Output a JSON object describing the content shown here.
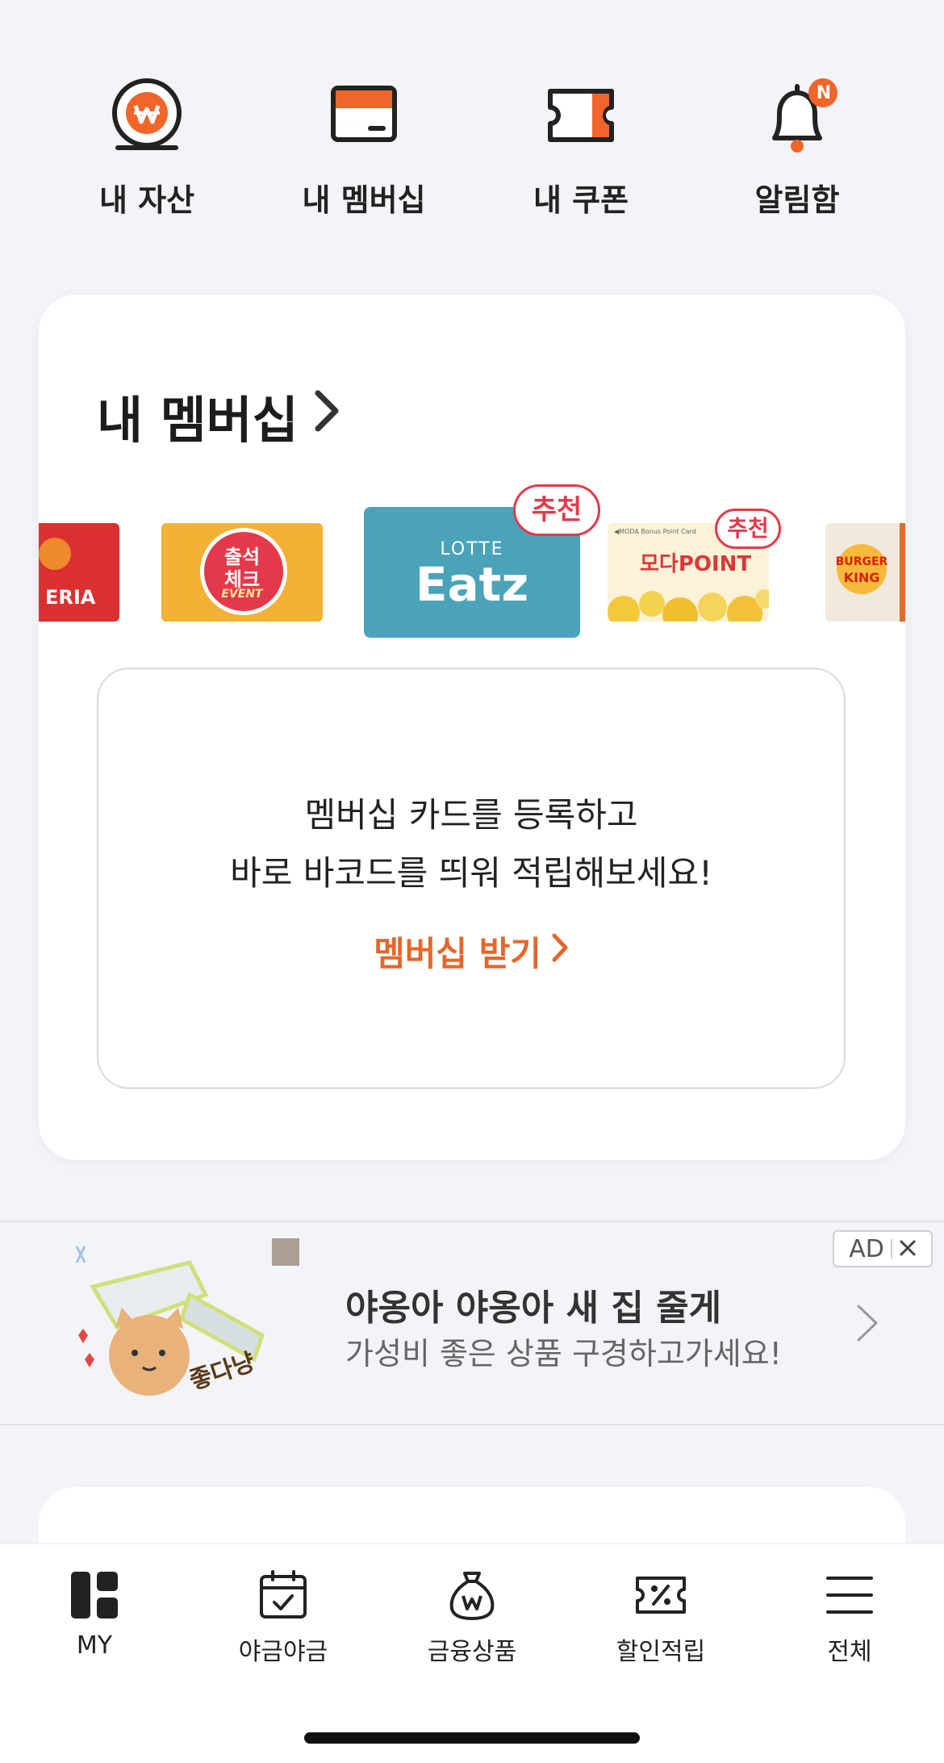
{
  "quick_menu": {
    "assets_label": "내 자산",
    "membership_label": "내 멤버십",
    "coupon_label": "내 쿠폰",
    "alarm_label": "알림함",
    "alarm_badge": "N"
  },
  "membership": {
    "title": "내 멤버십",
    "cards": {
      "card1_text": "ERIA",
      "card2_line1": "출석",
      "card2_line2": "체크",
      "card2_line3": "EVENT",
      "card3_line1": "LOTTE",
      "card3_line2": "Eatz",
      "card3_badge": "추천",
      "card4_small": "◀MODA Bonus Point Card",
      "card4_text": "모다POINT",
      "card4_badge": "추천",
      "card5_line1": "BURGER",
      "card5_line2": "KING"
    },
    "register_line1": "멤버십 카드를 등록하고",
    "register_line2": "바로 바코드를 띄워 적립해보세요!",
    "register_cta": "멤버십 받기"
  },
  "ad": {
    "tag": "AD",
    "headline": "야옹아 야옹아 새 집 줄게",
    "sub": "가성비 좋은 상품 구경하고가세요!",
    "image_text": "좋다냥"
  },
  "bottom_nav": {
    "my": "MY",
    "yageum": "야금야금",
    "finance": "금융상품",
    "discount": "할인적립",
    "all": "전체"
  },
  "colors": {
    "accent_orange": "#f0652a",
    "recommend_red": "#e23a4a",
    "eatz_teal": "#4aa3b8",
    "background": "#f3f4f8"
  }
}
